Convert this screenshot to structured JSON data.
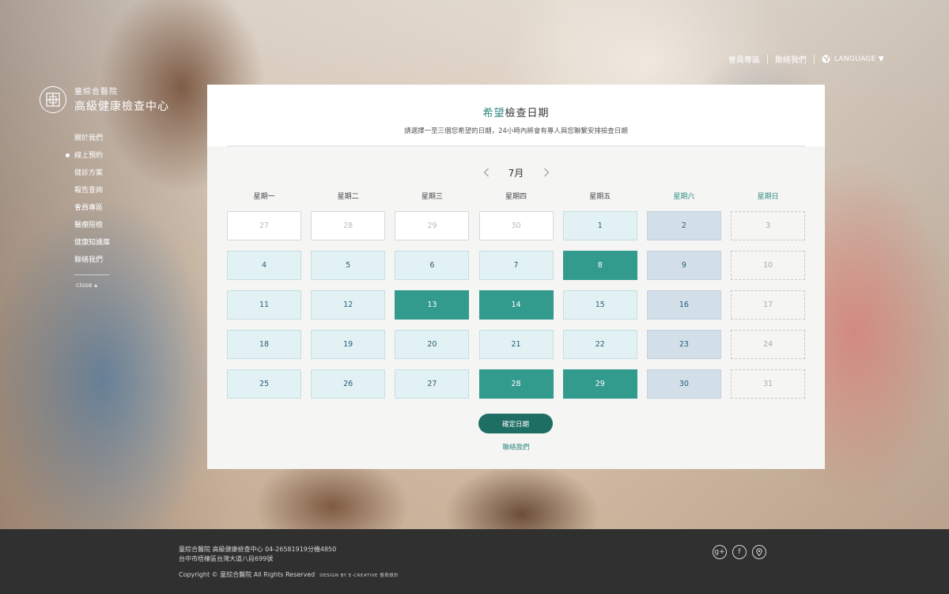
{
  "topnav": {
    "member": "會員專區",
    "contact": "聯絡我們",
    "language": "LANGUAGE ▼"
  },
  "logo": {
    "line1": "童綜合醫院",
    "line2": "高級健康檢查中心"
  },
  "sidemenu": {
    "items": [
      "關於我們",
      "線上預約",
      "健診方案",
      "報告查詢",
      "會員專區",
      "醫療陪檢",
      "健康知識庫",
      "聯絡我們"
    ],
    "active_index": 1,
    "close": "close ▴"
  },
  "panel": {
    "title_accent": "希望",
    "title_rest": "檢查日期",
    "subtitle": "請選擇一至三個您希望的日期，24小時內將會有專人與您聯繫安排檢查日期",
    "month": "7月",
    "weekdays": [
      "星期一",
      "星期二",
      "星期三",
      "星期四",
      "星期五",
      "星期六",
      "星期日"
    ],
    "confirm": "確定日期",
    "contact": "聯絡我們"
  },
  "calendar": {
    "cells": [
      {
        "d": "27",
        "s": "prev"
      },
      {
        "d": "28",
        "s": "prev"
      },
      {
        "d": "29",
        "s": "prev"
      },
      {
        "d": "30",
        "s": "prev"
      },
      {
        "d": "1",
        "s": "avail"
      },
      {
        "d": "2",
        "s": "sat"
      },
      {
        "d": "3",
        "s": "sun"
      },
      {
        "d": "4",
        "s": "avail"
      },
      {
        "d": "5",
        "s": "avail"
      },
      {
        "d": "6",
        "s": "avail"
      },
      {
        "d": "7",
        "s": "avail"
      },
      {
        "d": "8",
        "s": "sel"
      },
      {
        "d": "9",
        "s": "sat"
      },
      {
        "d": "10",
        "s": "sun"
      },
      {
        "d": "11",
        "s": "avail"
      },
      {
        "d": "12",
        "s": "avail"
      },
      {
        "d": "13",
        "s": "sel"
      },
      {
        "d": "14",
        "s": "sel"
      },
      {
        "d": "15",
        "s": "avail"
      },
      {
        "d": "16",
        "s": "sat"
      },
      {
        "d": "17",
        "s": "sun"
      },
      {
        "d": "18",
        "s": "avail"
      },
      {
        "d": "19",
        "s": "avail"
      },
      {
        "d": "20",
        "s": "avail"
      },
      {
        "d": "21",
        "s": "avail"
      },
      {
        "d": "22",
        "s": "avail"
      },
      {
        "d": "23",
        "s": "sat"
      },
      {
        "d": "24",
        "s": "sun"
      },
      {
        "d": "25",
        "s": "avail"
      },
      {
        "d": "26",
        "s": "avail"
      },
      {
        "d": "27",
        "s": "avail"
      },
      {
        "d": "28",
        "s": "sel"
      },
      {
        "d": "29",
        "s": "sel"
      },
      {
        "d": "30",
        "s": "sat"
      },
      {
        "d": "31",
        "s": "sun"
      }
    ]
  },
  "footer": {
    "line1": "童綜合醫院 高級健康檢查中心 04-26581919分機4850",
    "line2": "台中市梧棲區台灣大道八段699號",
    "copyright": "Copyright © 童綜合醫院 All Rights Reserved",
    "design": "DESIGN BY E-CREATIVE 億奇設計"
  },
  "social": [
    "google-plus-icon",
    "facebook-icon",
    "location-icon"
  ],
  "colors": {
    "accent": "#2e8a80",
    "selected": "#339a8e",
    "confirm_button": "#1f6e64",
    "footer_bg": "#303030"
  }
}
